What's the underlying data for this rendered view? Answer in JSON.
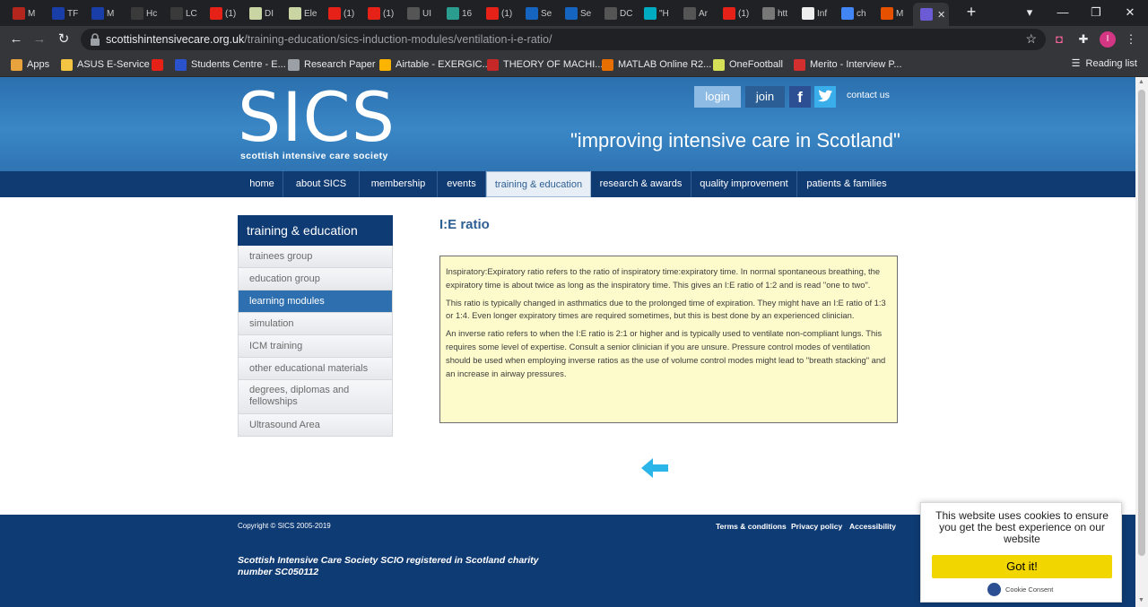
{
  "browser": {
    "tabs": [
      {
        "label": "M",
        "color": "#b3261e"
      },
      {
        "label": "TF",
        "color": "#1a3ea8"
      },
      {
        "label": "M",
        "color": "#1a3ea8"
      },
      {
        "label": "Hc",
        "color": "#3a3a3a"
      },
      {
        "label": "LC",
        "color": "#3a3a3a"
      },
      {
        "label": "(1)",
        "color": "#e62117"
      },
      {
        "label": "DI",
        "color": "#c9d6a3"
      },
      {
        "label": "Ele",
        "color": "#c9d6a3"
      },
      {
        "label": "(1)",
        "color": "#e62117"
      },
      {
        "label": "(1)",
        "color": "#e62117"
      },
      {
        "label": "UI",
        "color": "#555"
      },
      {
        "label": "16",
        "color": "#2a9d8f"
      },
      {
        "label": "(1)",
        "color": "#e62117"
      },
      {
        "label": "Se",
        "color": "#1565c0"
      },
      {
        "label": "Se",
        "color": "#1565c0"
      },
      {
        "label": "DC",
        "color": "#555"
      },
      {
        "label": "\"H",
        "color": "#00acc1"
      },
      {
        "label": "Ar",
        "color": "#555"
      },
      {
        "label": "(1)",
        "color": "#e62117"
      },
      {
        "label": "htt",
        "color": "#777"
      },
      {
        "label": "Inf",
        "color": "#eee"
      },
      {
        "label": "ch",
        "color": "#4285f4"
      },
      {
        "label": "M",
        "color": "#e65100"
      }
    ],
    "active_tab_label": "",
    "url_domain": "scottishintensivecare.org.uk",
    "url_path": "/training-education/sics-induction-modules/ventilation-i-e-ratio/",
    "avatar_letter": "I",
    "bookmarks": [
      {
        "label": "Apps",
        "color": "#e8a33d"
      },
      {
        "label": "ASUS E-Service",
        "color": "#f4c542"
      },
      {
        "label": "",
        "color": "#e62117"
      },
      {
        "label": "Students Centre - E...",
        "color": "#2952cc"
      },
      {
        "label": "Research Paper",
        "color": "#9aa0a6"
      },
      {
        "label": "Airtable - EXERGIC...",
        "color": "#fcb400"
      },
      {
        "label": "THEORY OF MACHI...",
        "color": "#c62828"
      },
      {
        "label": "MATLAB Online R2...",
        "color": "#e76f00"
      },
      {
        "label": "OneFootball",
        "color": "#d4e157"
      },
      {
        "label": "Merito - Interview P...",
        "color": "#d32f2f"
      }
    ],
    "reading_list": "Reading list"
  },
  "site": {
    "logo": "SICS",
    "logo_sub": "scottish intensive care society",
    "tagline": "\"improving intensive care in Scotland\"",
    "login": "login",
    "join": "join",
    "contact": "contact us",
    "nav": [
      {
        "label": "home"
      },
      {
        "label": "about SICS"
      },
      {
        "label": "membership"
      },
      {
        "label": "events"
      },
      {
        "label": "training & education"
      },
      {
        "label": "research & awards"
      },
      {
        "label": "quality improvement"
      },
      {
        "label": "patients & families"
      }
    ]
  },
  "sidebar": {
    "title": "training & education",
    "items": [
      {
        "label": "trainees group"
      },
      {
        "label": "education group"
      },
      {
        "label": "learning modules"
      },
      {
        "label": "simulation"
      },
      {
        "label": "ICM training"
      },
      {
        "label": "other educational materials"
      },
      {
        "label": "degrees, diplomas and fellowships"
      },
      {
        "label": "Ultrasound Area"
      }
    ]
  },
  "content": {
    "title": "I:E ratio",
    "paragraphs": [
      "Inspiratory:Expiratory ratio refers to the ratio of inspiratory time:expiratory time. In normal spontaneous breathing, the expiratory time is about twice as long as the inspiratory time. This gives an I:E ratio of 1:2 and is read \"one to two\".",
      "This ratio is typically changed in asthmatics due to the prolonged time of expiration. They might have an I:E ratio of 1:3 or 1:4. Even longer expiratory times are required sometimes, but this is best done by an experienced clinician.",
      "An inverse ratio refers to when the I:E ratio is 2:1 or higher and is typically used to ventilate non-compliant lungs. This requires some level of expertise. Consult a senior clinician if you are unsure. Pressure control modes of ventilation should be used when employing inverse ratios as the use of volume control modes might lead to \"breath stacking\" and an increase in airway pressures."
    ]
  },
  "footer": {
    "copyright": "Copyright © SICS 2005-2019",
    "terms": "Terms & conditions",
    "privacy": "Privacy policy",
    "accessibility": "Accessibility",
    "charity": "Scottish Intensive Care Society SCIO registered in Scotland charity number SC050112"
  },
  "cookie": {
    "message": "This website uses cookies to ensure you get the best experience on our website",
    "button": "Got it!",
    "brand": "Cookie Consent"
  },
  "colors": {
    "header_blue": "#3a87c6",
    "nav_blue": "#103a72",
    "active_sidebar": "#2e6fb0",
    "infobox_bg": "#fdfbcb",
    "cookie_button": "#f1d600"
  }
}
